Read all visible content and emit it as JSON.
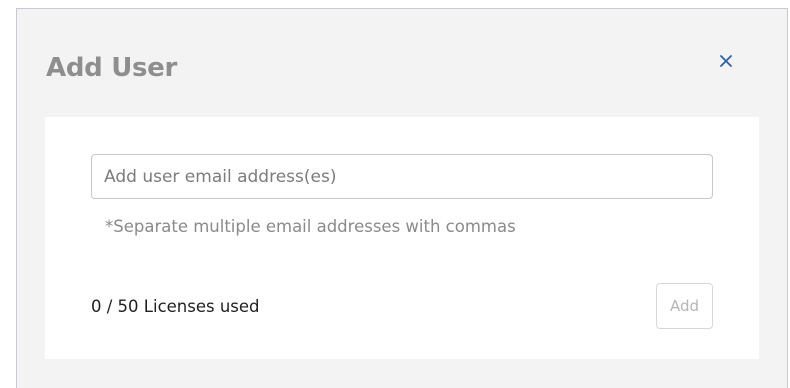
{
  "modal": {
    "title": "Add User",
    "close_icon": "close-icon"
  },
  "form": {
    "email_placeholder": "Add user email address(es)",
    "email_value": "",
    "hint": "*Separate multiple email addresses with commas",
    "licenses_used": 0,
    "licenses_total": 50,
    "license_text": "0 / 50 Licenses used",
    "add_label": "Add"
  },
  "colors": {
    "modal_background": "#f3f3f3",
    "card_background": "#ffffff",
    "title": "#8e8e8e",
    "close_icon": "#2f5fa6",
    "hint_text": "#8a8a8a",
    "disabled_button_text": "#b6b6b6"
  }
}
